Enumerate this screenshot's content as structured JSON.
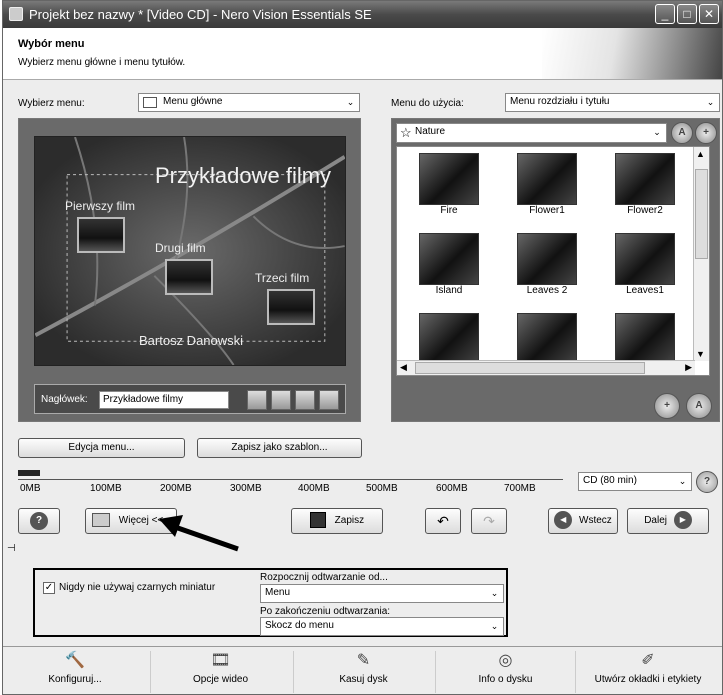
{
  "window": {
    "title": "Projekt bez nazwy * [Video CD] - Nero Vision Essentials SE"
  },
  "header": {
    "title": "Wybór menu",
    "subtitle": "Wybierz menu główne i menu tytułów."
  },
  "menu_select": {
    "label": "Wybierz menu:",
    "value": "Menu główne"
  },
  "menu_use": {
    "label": "Menu do użycia:",
    "value": "Menu rozdziału i tytułu"
  },
  "preview": {
    "title": "Przykładowe filmy",
    "items": [
      "Pierwszy film",
      "Drugi film",
      "Trzeci film"
    ],
    "author": "Bartosz Danowski"
  },
  "heading": {
    "label": "Nagłówek:",
    "value": "Przykładowe filmy"
  },
  "buttons": {
    "edit_menu": "Edycja menu...",
    "save_template": "Zapisz jako szablon..."
  },
  "templates": {
    "category": "Nature",
    "items": [
      {
        "name": "Fire"
      },
      {
        "name": "Flower1"
      },
      {
        "name": "Flower2"
      },
      {
        "name": "Island"
      },
      {
        "name": "Leaves 2"
      },
      {
        "name": "Leaves1"
      },
      {
        "name": ""
      },
      {
        "name": ""
      },
      {
        "name": ""
      }
    ],
    "top_btn_left": "A",
    "top_btn_right": "+",
    "bottom_btn_left": "+",
    "bottom_btn_right": "A"
  },
  "ruler": {
    "ticks": [
      "0MB",
      "100MB",
      "200MB",
      "300MB",
      "400MB",
      "500MB",
      "600MB",
      "700MB"
    ],
    "disk_type": "CD (80 min)"
  },
  "toolbar": {
    "help": "?",
    "more": "Więcej <<",
    "save": "Zapisz",
    "back": "Wstecz",
    "next": "Dalej"
  },
  "options": {
    "checkbox_label": "Nigdy nie używaj czarnych miniatur",
    "checkbox_mark": "✓",
    "start_label": "Rozpocznij odtwarzanie od...",
    "start_value": "Menu",
    "after_label": "Po zakończeniu odtwarzania:",
    "after_value": "Skocz do menu"
  },
  "bottom": {
    "configure": "Konfiguruj...",
    "video_options": "Opcje wideo",
    "erase_disc": "Kasuj dysk",
    "disc_info": "Info o dysku",
    "create_covers": "Utwórz okładki i etykiety"
  },
  "icons": {
    "chevron": "⌄",
    "star": "☆",
    "up": "▲",
    "down": "▼",
    "left": "◀",
    "right": "▶",
    "undo": "↶",
    "redo": "↷",
    "back_arrow": "◀",
    "next_arrow": "▶",
    "hammer": "🔨",
    "film": "🎞",
    "erase": "✎",
    "disc": "◎",
    "pen": "✐",
    "minimize": "_",
    "maximize": "□",
    "close": "✕"
  }
}
